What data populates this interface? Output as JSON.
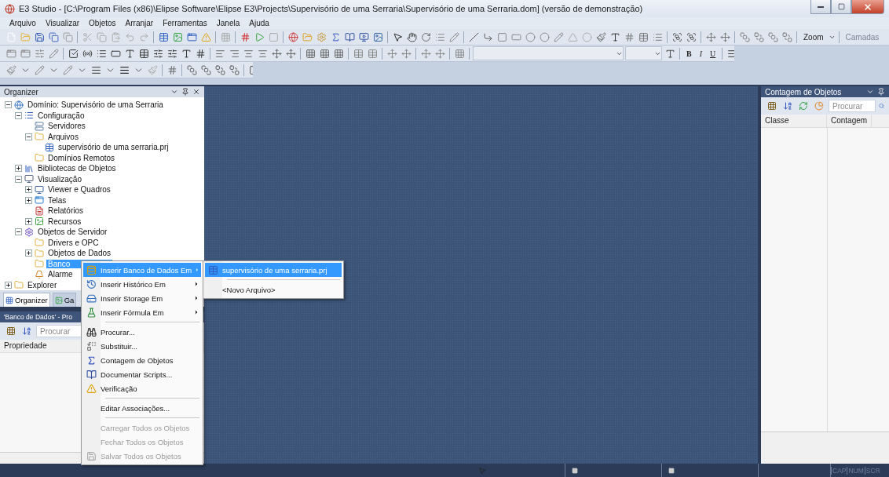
{
  "window": {
    "title": "E3 Studio - [C:\\Program Files (x86)\\Elipse Software\\Elipse E3\\Projects\\Supervisório de uma Serraria\\Supervisório de uma Serraria.dom] (versão de demonstração)"
  },
  "menu_bar": [
    "Arquivo",
    "Visualizar",
    "Objetos",
    "Arranjar",
    "Ferramentas",
    "Janela",
    "Ajuda"
  ],
  "toolbar_texts": {
    "zoom": "Zoom",
    "layers": "Camadas",
    "bold": "B",
    "italic": "I",
    "underline": "U"
  },
  "organizer": {
    "title": "Organizer",
    "tree": [
      {
        "label": "Domínio: Supervisório de uma Serraria",
        "kind": "domain",
        "expanded": true,
        "selected": false,
        "children": [
          {
            "label": "Configuração",
            "kind": "config",
            "expanded": true,
            "selected": false,
            "children": [
              {
                "label": "Servidores",
                "kind": "servers",
                "selected": false
              },
              {
                "label": "Arquivos",
                "kind": "folder",
                "expanded": true,
                "selected": false,
                "children": [
                  {
                    "label": "supervisório de uma serraria.prj",
                    "kind": "file",
                    "selected": false
                  }
                ]
              },
              {
                "label": "Domínios Remotos",
                "kind": "folder",
                "selected": false
              }
            ]
          },
          {
            "label": "Bibliotecas de Objetos",
            "kind": "library",
            "expanded": false,
            "selected": false
          },
          {
            "label": "Visualização",
            "kind": "view",
            "expanded": true,
            "selected": false,
            "children": [
              {
                "label": "Viewer e Quadros",
                "kind": "monitor",
                "expanded": false,
                "selected": false
              },
              {
                "label": "Telas",
                "kind": "screens",
                "expanded": false,
                "selected": false
              },
              {
                "label": "Relatórios",
                "kind": "report",
                "selected": false
              },
              {
                "label": "Recursos",
                "kind": "resources",
                "expanded": false,
                "selected": false
              }
            ]
          },
          {
            "label": "Objetos de Servidor",
            "kind": "gear",
            "expanded": true,
            "selected": false,
            "children": [
              {
                "label": "Drivers e OPC",
                "kind": "folder",
                "selected": false
              },
              {
                "label": "Objetos de Dados",
                "kind": "folder",
                "expanded": false,
                "selected": false
              },
              {
                "label": "Banco",
                "kind": "folder",
                "selected": true
              },
              {
                "label": "Alarme",
                "kind": "alarm",
                "selected": false
              }
            ]
          }
        ]
      },
      {
        "label": "Explorer",
        "kind": "folder",
        "expanded": false,
        "selected": false
      }
    ]
  },
  "panel_tabs": [
    {
      "label": "Organizer",
      "selected": true
    },
    {
      "label": "Ga",
      "selected": false
    }
  ],
  "properties": {
    "title": "'Banco de Dados' - Pro",
    "search": {
      "placeholder": "Procurar"
    },
    "column": "Propriedade"
  },
  "object_count": {
    "title": "Contagem de Objetos",
    "search": {
      "placeholder": "Procurar"
    },
    "columns": [
      "Classe",
      "Contagem"
    ]
  },
  "context_menu": [
    {
      "kind": "item",
      "label": "Inserir Banco de Dados Em",
      "submenu": true,
      "selected": true,
      "disabled": false
    },
    {
      "kind": "item",
      "label": "Inserir Histórico Em",
      "submenu": true,
      "selected": false,
      "disabled": false
    },
    {
      "kind": "item",
      "label": "Inserir Storage Em",
      "submenu": true,
      "selected": false,
      "disabled": false
    },
    {
      "kind": "item",
      "label": "Inserir Fórmula Em",
      "submenu": true,
      "selected": false,
      "disabled": false
    },
    {
      "kind": "separator"
    },
    {
      "kind": "item",
      "label": "Procurar...",
      "submenu": false,
      "selected": false,
      "disabled": false
    },
    {
      "kind": "item",
      "label": "Substituir...",
      "submenu": false,
      "selected": false,
      "disabled": false
    },
    {
      "kind": "item",
      "label": "Contagem de Objetos",
      "submenu": false,
      "selected": false,
      "disabled": false
    },
    {
      "kind": "item",
      "label": "Documentar Scripts...",
      "submenu": false,
      "selected": false,
      "disabled": false
    },
    {
      "kind": "item",
      "label": "Verificação",
      "submenu": false,
      "selected": false,
      "disabled": false
    },
    {
      "kind": "separator"
    },
    {
      "kind": "item",
      "label": "Editar Associações...",
      "submenu": false,
      "selected": false,
      "disabled": false
    },
    {
      "kind": "separator"
    },
    {
      "kind": "item",
      "label": "Carregar Todos os Objetos",
      "submenu": false,
      "selected": false,
      "disabled": true
    },
    {
      "kind": "item",
      "label": "Fechar Todos os Objetos",
      "submenu": false,
      "selected": false,
      "disabled": true
    },
    {
      "kind": "item",
      "label": "Salvar Todos os Objetos",
      "submenu": false,
      "selected": false,
      "disabled": true
    }
  ],
  "submenu": [
    {
      "kind": "item",
      "label": "supervisório de uma serraria.prj",
      "selected": true
    },
    {
      "kind": "separator"
    },
    {
      "kind": "item",
      "label": "<Novo Arquivo>",
      "selected": false
    }
  ],
  "status_bar": {
    "indicators": [
      "CAP",
      "NUM",
      "SCR"
    ]
  }
}
